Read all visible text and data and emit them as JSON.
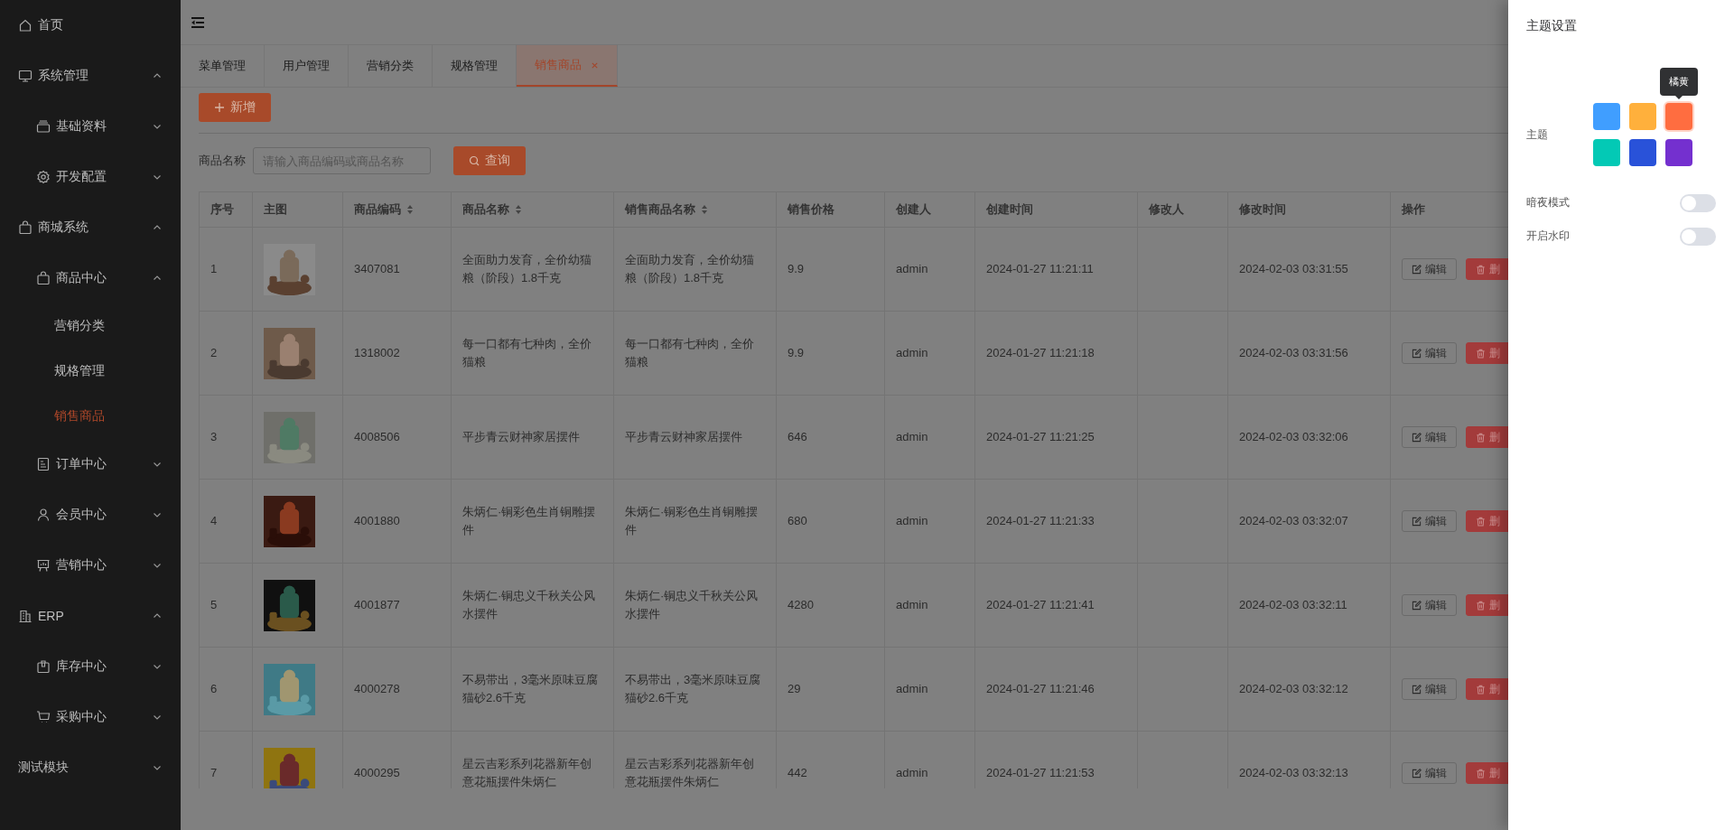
{
  "sidebar": {
    "items": [
      {
        "label": "首页"
      },
      {
        "label": "系统管理",
        "expanded": true,
        "children": [
          {
            "label": "基础资料",
            "expanded": false
          },
          {
            "label": "开发配置",
            "expanded": false
          }
        ]
      },
      {
        "label": "商城系统",
        "expanded": true,
        "children": [
          {
            "label": "商品中心",
            "expanded": true,
            "children": [
              {
                "label": "营销分类",
                "selected": false
              },
              {
                "label": "规格管理",
                "selected": false
              },
              {
                "label": "销售商品",
                "selected": true
              }
            ]
          },
          {
            "label": "订单中心",
            "expanded": false
          },
          {
            "label": "会员中心",
            "expanded": false
          },
          {
            "label": "营销中心",
            "expanded": false
          }
        ]
      },
      {
        "label": "ERP",
        "expanded": true,
        "children": [
          {
            "label": "库存中心",
            "expanded": false
          },
          {
            "label": "采购中心",
            "expanded": false
          }
        ]
      },
      {
        "label": "测试模块",
        "expanded": false
      }
    ]
  },
  "tabs": [
    {
      "label": "菜单管理",
      "selected": false
    },
    {
      "label": "用户管理",
      "selected": false
    },
    {
      "label": "营销分类",
      "selected": false
    },
    {
      "label": "规格管理",
      "selected": false
    },
    {
      "label": "销售商品",
      "selected": true
    }
  ],
  "add_button": "新增",
  "search": {
    "label": "商品名称",
    "placeholder": "请输入商品编码或商品名称",
    "button": "查询"
  },
  "table": {
    "columns": [
      {
        "label": "序号",
        "sortable": false
      },
      {
        "label": "主图",
        "sortable": false
      },
      {
        "label": "商品编码",
        "sortable": true
      },
      {
        "label": "商品名称",
        "sortable": true
      },
      {
        "label": "销售商品名称",
        "sortable": true
      },
      {
        "label": "销售价格",
        "sortable": false
      },
      {
        "label": "创建人",
        "sortable": false
      },
      {
        "label": "创建时间",
        "sortable": false
      },
      {
        "label": "修改人",
        "sortable": false
      },
      {
        "label": "修改时间",
        "sortable": false
      },
      {
        "label": "操作",
        "sortable": false
      }
    ],
    "rows": [
      {
        "no": "1",
        "code": "3407081",
        "name": "全面助力发育，全价幼猫粮（阶段）1.8千克",
        "sale_name": "全面助力发育，全价幼猫粮（阶段）1.8千克",
        "price": "9.9",
        "creator": "admin",
        "created": "2024-01-27 11:21:11",
        "modified": "2024-02-03 03:31:55",
        "edit": "编辑",
        "delete": "删"
      },
      {
        "no": "2",
        "code": "1318002",
        "name": "每一口都有七种肉，全价猫粮",
        "sale_name": "每一口都有七种肉，全价猫粮",
        "price": "9.9",
        "creator": "admin",
        "created": "2024-01-27 11:21:18",
        "modified": "2024-02-03 03:31:56",
        "edit": "编辑",
        "delete": "删"
      },
      {
        "no": "3",
        "code": "4008506",
        "name": "平步青云财神家居摆件",
        "sale_name": "平步青云财神家居摆件",
        "price": "646",
        "creator": "admin",
        "created": "2024-01-27 11:21:25",
        "modified": "2024-02-03 03:32:06",
        "edit": "编辑",
        "delete": "删"
      },
      {
        "no": "4",
        "code": "4001880",
        "name": "朱炳仁·铜彩色生肖铜雕摆件",
        "sale_name": "朱炳仁·铜彩色生肖铜雕摆件",
        "price": "680",
        "creator": "admin",
        "created": "2024-01-27 11:21:33",
        "modified": "2024-02-03 03:32:07",
        "edit": "编辑",
        "delete": "删"
      },
      {
        "no": "5",
        "code": "4001877",
        "name": "朱炳仁·铜忠义千秋关公风水摆件",
        "sale_name": "朱炳仁·铜忠义千秋关公风水摆件",
        "price": "4280",
        "creator": "admin",
        "created": "2024-01-27 11:21:41",
        "modified": "2024-02-03 03:32:11",
        "edit": "编辑",
        "delete": "删"
      },
      {
        "no": "6",
        "code": "4000278",
        "name": "不易带出，3毫米原味豆腐猫砂2.6千克",
        "sale_name": "不易带出，3毫米原味豆腐猫砂2.6千克",
        "price": "29",
        "creator": "admin",
        "created": "2024-01-27 11:21:46",
        "modified": "2024-02-03 03:32:12",
        "edit": "编辑",
        "delete": "删"
      },
      {
        "no": "7",
        "code": "4000295",
        "name": "星云吉彩系列花器新年创意花瓶摆件朱炳仁",
        "sale_name": "星云吉彩系列花器新年创意花瓶摆件朱炳仁",
        "price": "442",
        "creator": "admin",
        "created": "2024-01-27 11:21:53",
        "modified": "2024-02-03 03:32:13",
        "edit": "编辑",
        "delete": "删"
      }
    ]
  },
  "drawer": {
    "title": "主题设置",
    "theme_label": "主题",
    "tooltip": "橘黄",
    "swatches": [
      {
        "color": "#409eff",
        "hovered": false
      },
      {
        "color": "#ffb03c",
        "hovered": false
      },
      {
        "color": "#ff6d40",
        "hovered": true
      },
      {
        "color": "#03c9b5",
        "hovered": false
      },
      {
        "color": "#2952d9",
        "hovered": false
      },
      {
        "color": "#7430cf",
        "hovered": false
      }
    ],
    "settings": [
      {
        "label": "暗夜模式",
        "on": false
      },
      {
        "label": "开启水印",
        "on": false
      }
    ]
  }
}
